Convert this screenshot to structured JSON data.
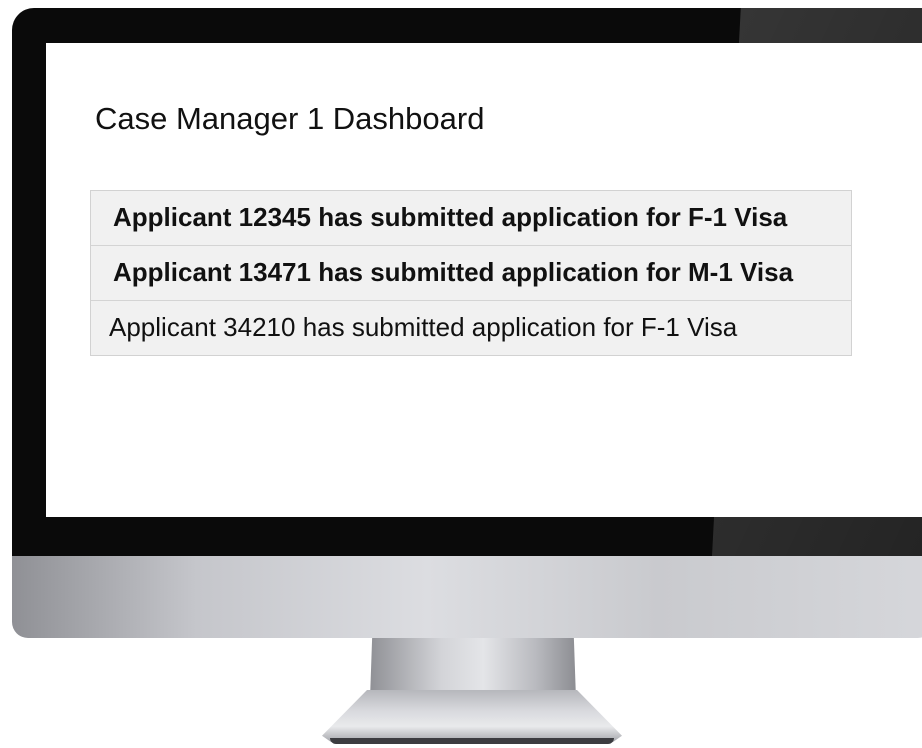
{
  "dashboard": {
    "title": "Case Manager 1 Dashboard"
  },
  "notifications": [
    {
      "text": "Applicant 12345 has submitted application for F-1 Visa",
      "unread": true
    },
    {
      "text": "Applicant 13471 has submitted application for M-1 Visa",
      "unread": true
    },
    {
      "text": "Applicant 34210 has submitted application for F-1 Visa",
      "unread": false
    }
  ]
}
